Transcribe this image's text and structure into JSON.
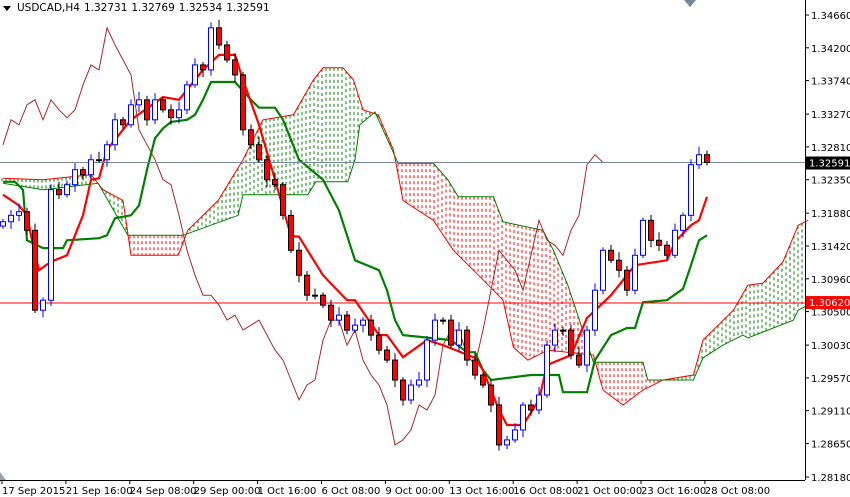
{
  "header": {
    "symbol_timeframe": "USDCAD,H4",
    "open": "1.32731",
    "high": "1.32769",
    "low": "1.32534",
    "close": "1.32591"
  },
  "chart_data": {
    "type": "candlestick",
    "title": "USDCAD,H4",
    "indicator": "Ichimoku Kinko Hyo",
    "ylim": [
      1.2818,
      1.3466
    ],
    "y_ticks": [
      "1.34660",
      "1.34200",
      "1.33740",
      "1.33270",
      "1.32810",
      "1.32350",
      "1.31880",
      "1.31420",
      "1.30960",
      "1.30500",
      "1.30030",
      "1.29570",
      "1.29110",
      "1.28650",
      "1.28180"
    ],
    "x_labels": [
      "17 Sep 2015",
      "21 Sep 16:00",
      "24 Sep 08:00",
      "29 Sep 00:00",
      "1 Oct 16:00",
      "6 Oct 08:00",
      "9 Oct 00:00",
      "13 Oct 16:00",
      "16 Oct 08:00",
      "21 Oct 00:00",
      "23 Oct 16:00",
      "28 Oct 08:00"
    ],
    "first_open": 1.317,
    "closes": [
      1.3176,
      1.3185,
      1.319,
      1.3164,
      1.3052,
      1.3066,
      1.3221,
      1.3214,
      1.3228,
      1.3249,
      1.3242,
      1.3263,
      1.3263,
      1.3284,
      1.3319,
      1.3312,
      1.334,
      1.3347,
      1.3319,
      1.3347,
      1.3333,
      1.3322,
      1.3333,
      1.3368,
      1.3396,
      1.3389,
      1.3448,
      1.3424,
      1.3403,
      1.3382,
      1.3305,
      1.3284,
      1.3263,
      1.3235,
      1.3228,
      1.3185,
      1.3136,
      1.3101,
      1.3073,
      1.3073,
      1.3059,
      1.3038,
      1.3045,
      1.3024,
      1.3031,
      1.3038,
      1.3017,
      1.2996,
      1.2982,
      1.2954,
      1.2926,
      1.2947,
      1.2954,
      1.301,
      1.3038,
      1.3038,
      1.3003,
      1.3024,
      1.2982,
      1.2961,
      1.2947,
      1.2919,
      1.2863,
      1.287,
      1.2884,
      1.2919,
      1.2912,
      1.2933,
      1.3003,
      1.3024,
      1.3024,
      1.2989,
      1.2975,
      1.3024,
      1.308,
      1.3136,
      1.3122,
      1.3108,
      1.308,
      1.3129,
      1.3178,
      1.315,
      1.3143,
      1.3129,
      1.3164,
      1.3185,
      1.3256,
      1.327,
      1.32591
    ],
    "tenkan_sen": [
      [
        0,
        1.3214
      ],
      [
        2,
        1.3199
      ],
      [
        3,
        1.3185
      ],
      [
        3.75,
        1.3143
      ],
      [
        4.5,
        1.3108
      ],
      [
        6,
        1.312
      ],
      [
        8,
        1.3129
      ],
      [
        10,
        1.3185
      ],
      [
        11,
        1.3235
      ],
      [
        12,
        1.3237
      ],
      [
        13,
        1.3277
      ],
      [
        16,
        1.3319
      ],
      [
        20,
        1.3351
      ],
      [
        22,
        1.3347
      ],
      [
        25,
        1.3389
      ],
      [
        27,
        1.341
      ],
      [
        29,
        1.341
      ],
      [
        30,
        1.3375
      ],
      [
        32,
        1.3312
      ],
      [
        34,
        1.3235
      ],
      [
        36,
        1.3156
      ],
      [
        37,
        1.3155
      ],
      [
        40,
        1.3101
      ],
      [
        43,
        1.3066
      ],
      [
        44,
        1.3066
      ],
      [
        47,
        1.3017
      ],
      [
        48,
        1.3017
      ],
      [
        50,
        1.2986
      ],
      [
        53,
        1.301
      ],
      [
        55,
        1.3003
      ],
      [
        59,
        1.2985
      ],
      [
        60,
        1.2968
      ],
      [
        62,
        1.2912
      ],
      [
        63,
        1.2891
      ],
      [
        65,
        1.2891
      ],
      [
        67,
        1.2926
      ],
      [
        68,
        1.2975
      ],
      [
        71,
        1.2989
      ],
      [
        73,
        1.3041
      ],
      [
        76,
        1.3073
      ],
      [
        79,
        1.3115
      ],
      [
        83,
        1.3122
      ],
      [
        84,
        1.3148
      ],
      [
        86,
        1.3171
      ],
      [
        87,
        1.3178
      ],
      [
        88,
        1.3211
      ]
    ],
    "kijun_sen": [
      [
        0,
        1.3232
      ],
      [
        1.5,
        1.3232
      ],
      [
        2.5,
        1.3221
      ],
      [
        3,
        1.315
      ],
      [
        5,
        1.3139
      ],
      [
        7.5,
        1.3139
      ],
      [
        8,
        1.315
      ],
      [
        12,
        1.3153
      ],
      [
        13,
        1.3157
      ],
      [
        14,
        1.3181
      ],
      [
        16,
        1.3185
      ],
      [
        17,
        1.3199
      ],
      [
        18,
        1.3249
      ],
      [
        19,
        1.3293
      ],
      [
        20,
        1.3307
      ],
      [
        21,
        1.3316
      ],
      [
        23,
        1.3319
      ],
      [
        24,
        1.3326
      ],
      [
        25,
        1.3347
      ],
      [
        26,
        1.3372
      ],
      [
        29,
        1.3372
      ],
      [
        31,
        1.3347
      ],
      [
        32,
        1.3336
      ],
      [
        34,
        1.3336
      ],
      [
        35,
        1.3319
      ],
      [
        37,
        1.3263
      ],
      [
        40,
        1.3235
      ],
      [
        42,
        1.3192
      ],
      [
        43,
        1.3157
      ],
      [
        44,
        1.3122
      ],
      [
        47,
        1.3108
      ],
      [
        48,
        1.308
      ],
      [
        49,
        1.3038
      ],
      [
        50,
        1.3017
      ],
      [
        56,
        1.301
      ],
      [
        58,
        1.2993
      ],
      [
        59,
        1.2993
      ],
      [
        60,
        1.2968
      ],
      [
        61,
        1.2954
      ],
      [
        66,
        1.2961
      ],
      [
        69.5,
        1.2961
      ],
      [
        70,
        1.2937
      ],
      [
        73,
        1.2937
      ],
      [
        74,
        1.2982
      ],
      [
        76,
        1.3017
      ],
      [
        78,
        1.3027
      ],
      [
        79,
        1.3027
      ],
      [
        80,
        1.3063
      ],
      [
        83,
        1.3066
      ],
      [
        85,
        1.3082
      ],
      [
        86,
        1.3115
      ],
      [
        87,
        1.315
      ],
      [
        88,
        1.3157
      ]
    ],
    "senkou_span_a": [
      [
        0,
        1.3237
      ],
      [
        5,
        1.3235
      ],
      [
        11,
        1.3242
      ],
      [
        12.5,
        1.3221
      ],
      [
        15,
        1.3206
      ],
      [
        16,
        1.3129
      ],
      [
        21.9,
        1.3129
      ],
      [
        23.1,
        1.3164
      ],
      [
        26.9,
        1.3206
      ],
      [
        30,
        1.3263
      ],
      [
        32.5,
        1.3319
      ],
      [
        36.3,
        1.3326
      ],
      [
        38.8,
        1.3375
      ],
      [
        40,
        1.3392
      ],
      [
        42.5,
        1.3392
      ],
      [
        43.8,
        1.3375
      ],
      [
        45,
        1.3333
      ],
      [
        46.9,
        1.3326
      ],
      [
        48.8,
        1.3277
      ],
      [
        50,
        1.3206
      ],
      [
        53.8,
        1.3178
      ],
      [
        56.3,
        1.3136
      ],
      [
        58.8,
        1.3108
      ],
      [
        61.3,
        1.308
      ],
      [
        62.5,
        1.3066
      ],
      [
        63.8,
        1.3
      ],
      [
        65.6,
        1.2982
      ],
      [
        68.1,
        1.2996
      ],
      [
        73.8,
        1.2989
      ],
      [
        75,
        1.294
      ],
      [
        77.5,
        1.2919
      ],
      [
        80,
        1.294
      ],
      [
        82.5,
        1.2954
      ],
      [
        86.3,
        1.2961
      ],
      [
        87.5,
        1.301
      ],
      [
        91.3,
        1.3052
      ],
      [
        93.1,
        1.3087
      ],
      [
        95,
        1.309
      ],
      [
        97.5,
        1.312
      ],
      [
        99.4,
        1.3171
      ],
      [
        100.6,
        1.3178
      ]
    ],
    "senkou_span_b": [
      [
        0,
        1.323
      ],
      [
        5,
        1.3221
      ],
      [
        11.9,
        1.323
      ],
      [
        15.6,
        1.3157
      ],
      [
        22.5,
        1.3157
      ],
      [
        29.4,
        1.3185
      ],
      [
        30,
        1.3214
      ],
      [
        38.1,
        1.3214
      ],
      [
        39.1,
        1.3232
      ],
      [
        43.1,
        1.3232
      ],
      [
        44,
        1.3263
      ],
      [
        44.6,
        1.3312
      ],
      [
        46.5,
        1.333
      ],
      [
        47.5,
        1.3305
      ],
      [
        49.4,
        1.3258
      ],
      [
        53.8,
        1.3258
      ],
      [
        55.6,
        1.3235
      ],
      [
        56.9,
        1.3211
      ],
      [
        61.3,
        1.3211
      ],
      [
        62.5,
        1.3176
      ],
      [
        67.5,
        1.3164
      ],
      [
        68.8,
        1.3136
      ],
      [
        70.6,
        1.3087
      ],
      [
        73.8,
        1.2979
      ],
      [
        80,
        1.2979
      ],
      [
        80.6,
        1.2954
      ],
      [
        86.3,
        1.2954
      ],
      [
        87.5,
        1.2985
      ],
      [
        90,
        1.3003
      ],
      [
        92.5,
        1.3017
      ],
      [
        93.1,
        1.3013
      ],
      [
        98.8,
        1.3038
      ],
      [
        99.4,
        1.3052
      ],
      [
        100.6,
        1.3059
      ]
    ],
    "chikou_shift_bars": 13,
    "current_price": "1.32591",
    "horizontal_line": "1.30620",
    "colors": {
      "bull_candle": "#0000ff",
      "bear_candle_body": "#ff0000",
      "bear_candle_outline": "#000000",
      "tenkan": "#ff0000",
      "kijun": "#008000",
      "chikou": "#a52a2a",
      "cloud_bull": "#008000",
      "cloud_bear": "#ff0000",
      "price_line": "#778899",
      "horizontal_line": "#ff0000"
    }
  }
}
